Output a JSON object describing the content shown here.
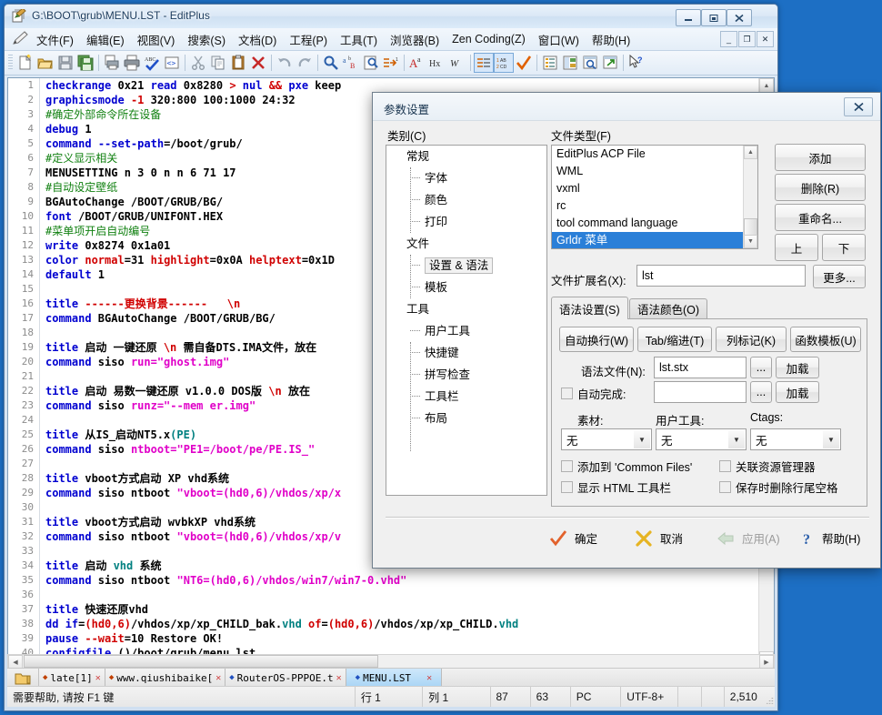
{
  "window": {
    "title": "G:\\BOOT\\grub\\MENU.LST - EditPlus",
    "minimize": "–",
    "maximize": "□",
    "close": "✕"
  },
  "menubar": {
    "items": [
      {
        "label": "文件(F)"
      },
      {
        "label": "编辑(E)"
      },
      {
        "label": "视图(V)"
      },
      {
        "label": "搜索(S)"
      },
      {
        "label": "文档(D)"
      },
      {
        "label": "工程(P)"
      },
      {
        "label": "工具(T)"
      },
      {
        "label": "浏览器(B)"
      },
      {
        "label": "Zen Coding(Z)"
      },
      {
        "label": "窗口(W)"
      },
      {
        "label": "帮助(H)"
      }
    ],
    "mdi": {
      "min": "_",
      "restore": "❐",
      "close": "✕"
    }
  },
  "toolbar": {
    "buttons": [
      "new-file-icon",
      "open-folder-icon",
      "save-icon",
      "save-all-icon",
      "sep",
      "print-preview-icon",
      "print-icon",
      "spellcheck-icon",
      "html-tag-icon",
      "sep",
      "cut-icon",
      "copy-icon",
      "paste-icon",
      "delete-icon",
      "sep",
      "undo-icon",
      "redo-icon",
      "sep",
      "find-icon",
      "replace-icon",
      "find-in-files-icon",
      "goto-line-icon",
      "sep",
      "change-case-icon",
      "hex-view-icon",
      "word-wrap-icon",
      "sep",
      "indent-icon",
      "column-mode-icon",
      "check-icon",
      "sep",
      "document-list-icon",
      "project-icon",
      "preview-browser-icon",
      "external-browser-icon",
      "sep",
      "help-cursor-icon"
    ]
  },
  "editor": {
    "first_line": 1,
    "lines": [
      {
        "n": 1,
        "segs": [
          [
            "kw",
            "checkrange"
          ],
          [
            "blk",
            " 0x21 "
          ],
          [
            "kw",
            "read"
          ],
          [
            "blk",
            " 0x8280 "
          ],
          [
            "red",
            ">"
          ],
          [
            "blk",
            " "
          ],
          [
            "kw",
            "nul"
          ],
          [
            "blk",
            " "
          ],
          [
            "red",
            "&&"
          ],
          [
            "blk",
            " "
          ],
          [
            "kw",
            "pxe"
          ],
          [
            "blk",
            " keep"
          ]
        ]
      },
      {
        "n": 2,
        "segs": [
          [
            "kw",
            "graphicsmode"
          ],
          [
            "blk",
            " "
          ],
          [
            "num",
            "-1"
          ],
          [
            "blk",
            " 320:800 100:1000 24:32"
          ]
        ]
      },
      {
        "n": 3,
        "segs": [
          [
            "cmt",
            "#确定外部命令所在设备"
          ]
        ]
      },
      {
        "n": 4,
        "segs": [
          [
            "kw",
            "debug"
          ],
          [
            "blk",
            " 1"
          ]
        ]
      },
      {
        "n": 5,
        "segs": [
          [
            "kw",
            "command"
          ],
          [
            "blk",
            " "
          ],
          [
            "kw",
            "--set-path"
          ],
          [
            "blk",
            "=/boot/grub/"
          ]
        ]
      },
      {
        "n": 6,
        "segs": [
          [
            "cmt",
            "#定义显示相关"
          ]
        ]
      },
      {
        "n": 7,
        "segs": [
          [
            "blk",
            "MENUSETTING n 3 0 n n 6 71 17"
          ]
        ]
      },
      {
        "n": 8,
        "segs": [
          [
            "cmt",
            "#自动设定壁纸"
          ]
        ]
      },
      {
        "n": 9,
        "segs": [
          [
            "blk",
            "BGAutoChange /BOOT/GRUB/BG/"
          ]
        ]
      },
      {
        "n": 10,
        "segs": [
          [
            "kw",
            "font"
          ],
          [
            "blk",
            " /BOOT/GRUB/UNIFONT.HEX"
          ]
        ]
      },
      {
        "n": 11,
        "segs": [
          [
            "cmt",
            "#菜单项开启自动编号"
          ]
        ]
      },
      {
        "n": 12,
        "segs": [
          [
            "kw",
            "write"
          ],
          [
            "blk",
            " 0x8274 0x1a01"
          ]
        ]
      },
      {
        "n": 13,
        "segs": [
          [
            "kw",
            "color"
          ],
          [
            "blk",
            " "
          ],
          [
            "red",
            "normal"
          ],
          [
            "blk",
            "=31 "
          ],
          [
            "red",
            "highlight"
          ],
          [
            "blk",
            "=0x0A "
          ],
          [
            "red",
            "helptext"
          ],
          [
            "blk",
            "=0x1D"
          ]
        ]
      },
      {
        "n": 14,
        "segs": [
          [
            "kw",
            "default"
          ],
          [
            "blk",
            " 1"
          ]
        ]
      },
      {
        "n": 15,
        "segs": []
      },
      {
        "n": 16,
        "segs": [
          [
            "kw",
            "title"
          ],
          [
            "blk",
            " "
          ],
          [
            "red",
            "------更换背景------"
          ],
          [
            "blk",
            "   "
          ],
          [
            "red",
            "\\n"
          ]
        ]
      },
      {
        "n": 17,
        "segs": [
          [
            "kw",
            "command"
          ],
          [
            "blk",
            " BGAutoChange /BOOT/GRUB/BG/"
          ]
        ]
      },
      {
        "n": 18,
        "segs": []
      },
      {
        "n": 19,
        "segs": [
          [
            "kw",
            "title"
          ],
          [
            "blk",
            " 启动 一键还原 "
          ],
          [
            "red",
            "\\n"
          ],
          [
            "blk",
            " 需自备DTS.IMA文件，放在"
          ]
        ]
      },
      {
        "n": 20,
        "segs": [
          [
            "kw",
            "command"
          ],
          [
            "blk",
            " siso "
          ],
          [
            "str",
            "run=\"ghost.img\""
          ]
        ]
      },
      {
        "n": 21,
        "segs": []
      },
      {
        "n": 22,
        "segs": [
          [
            "kw",
            "title"
          ],
          [
            "blk",
            " 启动 易数一键还原 v1.0.0 DOS版 "
          ],
          [
            "red",
            "\\n"
          ],
          [
            "blk",
            " 放在"
          ]
        ]
      },
      {
        "n": 23,
        "segs": [
          [
            "kw",
            "command"
          ],
          [
            "blk",
            " siso "
          ],
          [
            "str",
            "runz=\"--mem er.img\""
          ]
        ]
      },
      {
        "n": 24,
        "segs": []
      },
      {
        "n": 25,
        "segs": [
          [
            "kw",
            "title"
          ],
          [
            "blk",
            " 从IS_启动NT5.x"
          ],
          [
            "teal",
            "(PE)"
          ]
        ]
      },
      {
        "n": 26,
        "segs": [
          [
            "kw",
            "command"
          ],
          [
            "blk",
            " siso "
          ],
          [
            "str",
            "ntboot=\"PE1=/boot/pe/PE.IS_\""
          ]
        ]
      },
      {
        "n": 27,
        "segs": []
      },
      {
        "n": 28,
        "segs": [
          [
            "kw",
            "title"
          ],
          [
            "blk",
            " vboot方式启动 XP vhd系统"
          ]
        ]
      },
      {
        "n": 29,
        "segs": [
          [
            "kw",
            "command"
          ],
          [
            "blk",
            " siso ntboot "
          ],
          [
            "str",
            "\"vboot=(hd0,6)/vhdos/xp/x"
          ]
        ]
      },
      {
        "n": 30,
        "segs": []
      },
      {
        "n": 31,
        "segs": [
          [
            "kw",
            "title"
          ],
          [
            "blk",
            " vboot方式启动 wvbkXP vhd系统"
          ]
        ]
      },
      {
        "n": 32,
        "segs": [
          [
            "kw",
            "command"
          ],
          [
            "blk",
            " siso ntboot "
          ],
          [
            "str",
            "\"vboot=(hd0,6)/vhdos/xp/v"
          ]
        ]
      },
      {
        "n": 33,
        "segs": []
      },
      {
        "n": 34,
        "segs": [
          [
            "kw",
            "title"
          ],
          [
            "blk",
            " 启动 "
          ],
          [
            "teal",
            "vhd"
          ],
          [
            "blk",
            " 系统"
          ]
        ]
      },
      {
        "n": 35,
        "segs": [
          [
            "kw",
            "command"
          ],
          [
            "blk",
            " siso ntboot "
          ],
          [
            "str",
            "\"NT6=(hd0,6)/vhdos/win7/win7-0.vhd\""
          ]
        ]
      },
      {
        "n": 36,
        "segs": []
      },
      {
        "n": 37,
        "segs": [
          [
            "kw",
            "title"
          ],
          [
            "blk",
            " 快速还原vhd"
          ]
        ]
      },
      {
        "n": 38,
        "segs": [
          [
            "kw",
            "dd"
          ],
          [
            "blk",
            " "
          ],
          [
            "kw",
            "if"
          ],
          [
            "blk",
            "="
          ],
          [
            "red",
            "(hd0,6)"
          ],
          [
            "blk",
            "/vhdos/xp/xp_CHILD_bak."
          ],
          [
            "teal",
            "vhd"
          ],
          [
            "blk",
            " "
          ],
          [
            "red",
            "of"
          ],
          [
            "blk",
            "="
          ],
          [
            "red",
            "(hd0,6)"
          ],
          [
            "blk",
            "/vhdos/xp/xp_CHILD."
          ],
          [
            "teal",
            "vhd"
          ]
        ]
      },
      {
        "n": 39,
        "segs": [
          [
            "kw",
            "pause"
          ],
          [
            "blk",
            " "
          ],
          [
            "red",
            "--wait"
          ],
          [
            "blk",
            "=10 Restore OK!"
          ]
        ]
      },
      {
        "n": 40,
        "segs": [
          [
            "kw",
            "configfile"
          ],
          [
            "blk",
            " ()/boot/grub/menu.lst"
          ]
        ]
      }
    ]
  },
  "doctabs": {
    "folder_icon": "folder-icon",
    "items": [
      {
        "label": "late[1]",
        "active": false,
        "dot": "red"
      },
      {
        "label": "www.qiushibaike[",
        "active": false,
        "dot": "red"
      },
      {
        "label": "RouterOS-PPPOE.t",
        "active": false,
        "dot": "blue"
      },
      {
        "label": "MENU.LST",
        "active": true,
        "dot": "blue"
      }
    ],
    "close_glyph": "✕"
  },
  "statusbar": {
    "hint": "需要帮助, 请按 F1 键",
    "row": "行 1",
    "col": "列 1",
    "f3": "87",
    "f4": "63",
    "platform": "PC",
    "encoding": "UTF-8+",
    "f7": "",
    "f8": "",
    "size": "2,510"
  },
  "dialog": {
    "title": "参数设置",
    "close": "✕",
    "category_label": "类别(C)",
    "filetype_label": "文件类型(F)",
    "tree": [
      {
        "label": "常规",
        "level": 0,
        "selected": false
      },
      {
        "label": "字体",
        "level": 1,
        "selected": false
      },
      {
        "label": "颜色",
        "level": 1,
        "selected": false
      },
      {
        "label": "打印",
        "level": 1,
        "selected": false
      },
      {
        "label": "文件",
        "level": 0,
        "selected": false
      },
      {
        "label": "设置 & 语法",
        "level": 1,
        "selected": true
      },
      {
        "label": "模板",
        "level": 1,
        "selected": false
      },
      {
        "label": "工具",
        "level": 0,
        "selected": false
      },
      {
        "label": "用户工具",
        "level": 1,
        "selected": false
      },
      {
        "label": "快捷键",
        "level": 1,
        "selected": false
      },
      {
        "label": "拼写检查",
        "level": 1,
        "selected": false
      },
      {
        "label": "工具栏",
        "level": 1,
        "selected": false
      },
      {
        "label": "布局",
        "level": 1,
        "selected": false
      }
    ],
    "filetypes": [
      {
        "label": "EditPlus ACP File",
        "selected": false
      },
      {
        "label": "WML",
        "selected": false
      },
      {
        "label": "vxml",
        "selected": false
      },
      {
        "label": "rc",
        "selected": false
      },
      {
        "label": "tool command language",
        "selected": false
      },
      {
        "label": "Grldr 菜单",
        "selected": true
      }
    ],
    "side_buttons": [
      {
        "label": "添加",
        "name": "add-button"
      },
      {
        "label": "删除(R)",
        "name": "delete-button"
      },
      {
        "label": "重命名...",
        "name": "rename-button"
      }
    ],
    "move_up": "上",
    "move_down": "下",
    "ext_label": "文件扩展名(X):",
    "ext_value": "lst",
    "more_button": "更多...",
    "tabs": [
      {
        "label": "语法设置(S)",
        "active": true
      },
      {
        "label": "语法颜色(O)",
        "active": false
      }
    ],
    "row_buttons": [
      {
        "label": "自动换行(W)",
        "name": "word-wrap-button"
      },
      {
        "label": "Tab/缩进(T)",
        "name": "tab-indent-button"
      },
      {
        "label": "列标记(K)",
        "name": "column-marker-button"
      },
      {
        "label": "函数模板(U)",
        "name": "function-template-button"
      }
    ],
    "syntax_file_label": "语法文件(N):",
    "syntax_file_value": "lst.stx",
    "autocomplete_label": "自动完成:",
    "autocomplete_value": "",
    "browse_glyph": "...",
    "load_label": "加载",
    "clip_label": "素材:",
    "usertool_label": "用户工具:",
    "ctags_label": "Ctags:",
    "combo_none": "无",
    "checkboxes": [
      {
        "label": "添加到 'Common Files'",
        "name": "add-to-common-files-checkbox"
      },
      {
        "label": "关联资源管理器",
        "name": "associate-explorer-checkbox"
      },
      {
        "label": "显示 HTML 工具栏",
        "name": "show-html-toolbar-checkbox"
      },
      {
        "label": "保存时删除行尾空格",
        "name": "strip-trailing-space-checkbox"
      }
    ],
    "actions": [
      {
        "label": "确定",
        "icon": "check-icon",
        "disabled": false
      },
      {
        "label": "取消",
        "icon": "cross-icon",
        "disabled": false
      },
      {
        "label": "应用(A)",
        "icon": "arrow-left-icon",
        "disabled": true
      },
      {
        "label": "帮助(H)",
        "icon": "question-icon",
        "disabled": false
      }
    ]
  },
  "colors": {
    "accent": "#2a7fd8",
    "desktop": "#1d6fc4",
    "keyword": "#0000d0",
    "string": "#e000c8",
    "comment": "#108010",
    "number": "#d00000"
  }
}
